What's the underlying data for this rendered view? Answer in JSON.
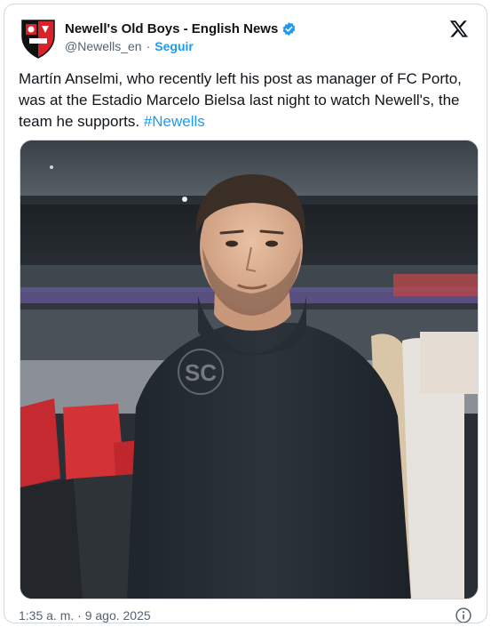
{
  "account": {
    "display_name": "Newell's Old Boys - English News",
    "handle": "@Newells_en",
    "separator": "·",
    "follow_label": "Seguir",
    "avatar_icon": "newells-crest-icon",
    "verified_icon": "verified-badge-icon",
    "verified_color": "#1d9bf0"
  },
  "tweet": {
    "text": "Martín Anselmi, who recently left his post as manager of FC Porto, was at the Estadio Marcelo Bielsa last night to watch Newell's, the team he supports. ",
    "hashtag": "#Newells",
    "timestamp": "1:35 a. m. · 9 ago. 2025",
    "watermark": "SC"
  },
  "icons": {
    "platform": "x-logo-icon",
    "info": "info-icon"
  },
  "colors": {
    "link": "#1d9bf0",
    "text": "#0f1419",
    "secondary": "#536471",
    "border": "#cfd9de",
    "crest_red": "#d8232a",
    "crest_black": "#111111"
  }
}
